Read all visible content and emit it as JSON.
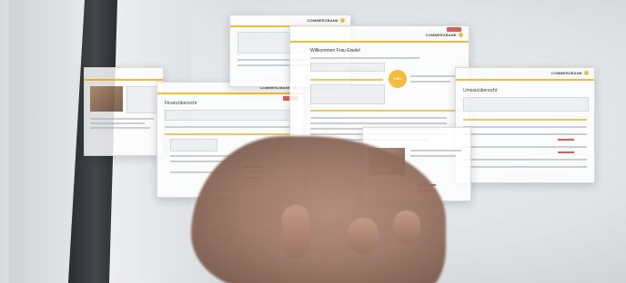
{
  "brand": {
    "name": "COMMERZBANK",
    "accent_color": "#f5b82e",
    "alert_color": "#d9534f"
  },
  "center_panel": {
    "headline": "Willkommen Frau Eisele!",
    "rate_badge": "0.5%"
  },
  "right_panel": {
    "headline": "Umsatzübersicht"
  },
  "left_panel": {
    "headline": "Finanzübersicht"
  },
  "scene": {
    "description_icon": "hand-icon"
  }
}
